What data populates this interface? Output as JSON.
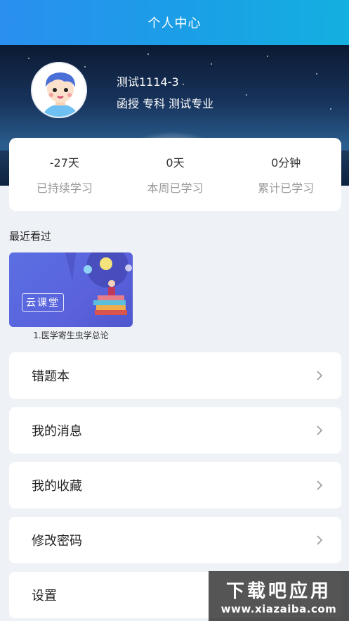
{
  "header": {
    "title": "个人中心"
  },
  "profile": {
    "name": "测试1114-3",
    "info": "函授 专科 测试专业"
  },
  "stats": [
    {
      "value": "-27天",
      "label": "已持续学习"
    },
    {
      "value": "0天",
      "label": "本周已学习"
    },
    {
      "value": "0分钟",
      "label": "累计已学习"
    }
  ],
  "recent": {
    "title": "最近看过",
    "items": [
      {
        "thumb_tag": "云课堂",
        "title": "1.医学寄生虫学总论"
      }
    ]
  },
  "menu": [
    {
      "label": "错题本"
    },
    {
      "label": "我的消息"
    },
    {
      "label": "我的收藏"
    },
    {
      "label": "修改密码"
    },
    {
      "label": "设置"
    }
  ],
  "watermark": {
    "main": "下载吧应用",
    "url": "www.xiazaiba.com"
  },
  "icons": {
    "chevron": "chevron-right-icon",
    "avatar": "avatar-cartoon"
  },
  "colors": {
    "header": "#1a9fe6",
    "background": "#eef1f6",
    "card": "#ffffff",
    "muted_text": "#9a9a9a"
  }
}
